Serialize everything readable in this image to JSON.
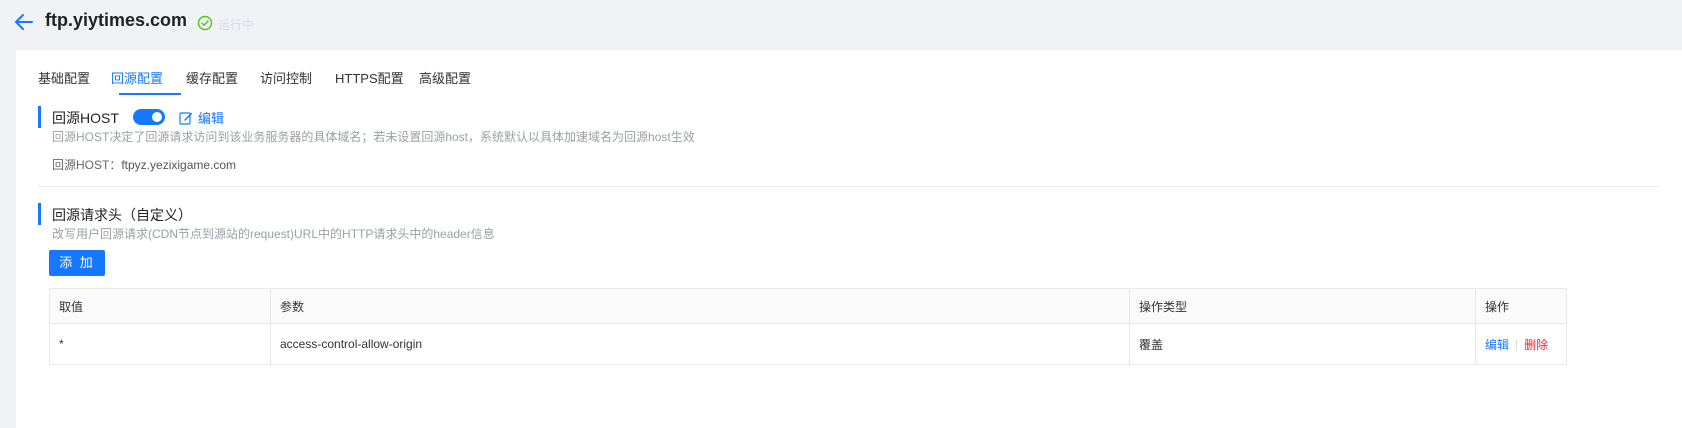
{
  "header": {
    "title": "ftp.yiytimes.com",
    "status_text": "运行中",
    "colors": {
      "accent": "#1677ff",
      "status_ok": "#52c41a",
      "danger": "#f5222d"
    }
  },
  "tabs": [
    {
      "label": "基础配置",
      "active": false
    },
    {
      "label": "回源配置",
      "active": true
    },
    {
      "label": "缓存配置",
      "active": false
    },
    {
      "label": "访问控制",
      "active": false
    },
    {
      "label": "HTTPS配置",
      "active": false
    },
    {
      "label": "高级配置",
      "active": false
    }
  ],
  "origin_host": {
    "title": "回源HOST",
    "enabled": true,
    "edit_label": "编辑",
    "description": "回源HOST决定了回源请求访问到该业务服务器的具体域名；若未设置回源host，系统默认以具体加速域名为回源host生效",
    "value_key": "回源HOST：",
    "value": "ftpyz.yezixigame.com"
  },
  "request_headers": {
    "title": "回源请求头（自定义）",
    "description": "改写用户回源请求(CDN节点到源站的request)URL中的HTTP请求头中的header信息",
    "add_label": "添 加",
    "columns": [
      "取值",
      "参数",
      "操作类型",
      "操作"
    ],
    "rows": [
      {
        "value": "*",
        "param": "access-control-allow-origin",
        "op_type": "覆盖",
        "edit": "编辑",
        "sep": "|",
        "delete": "删除"
      }
    ]
  }
}
